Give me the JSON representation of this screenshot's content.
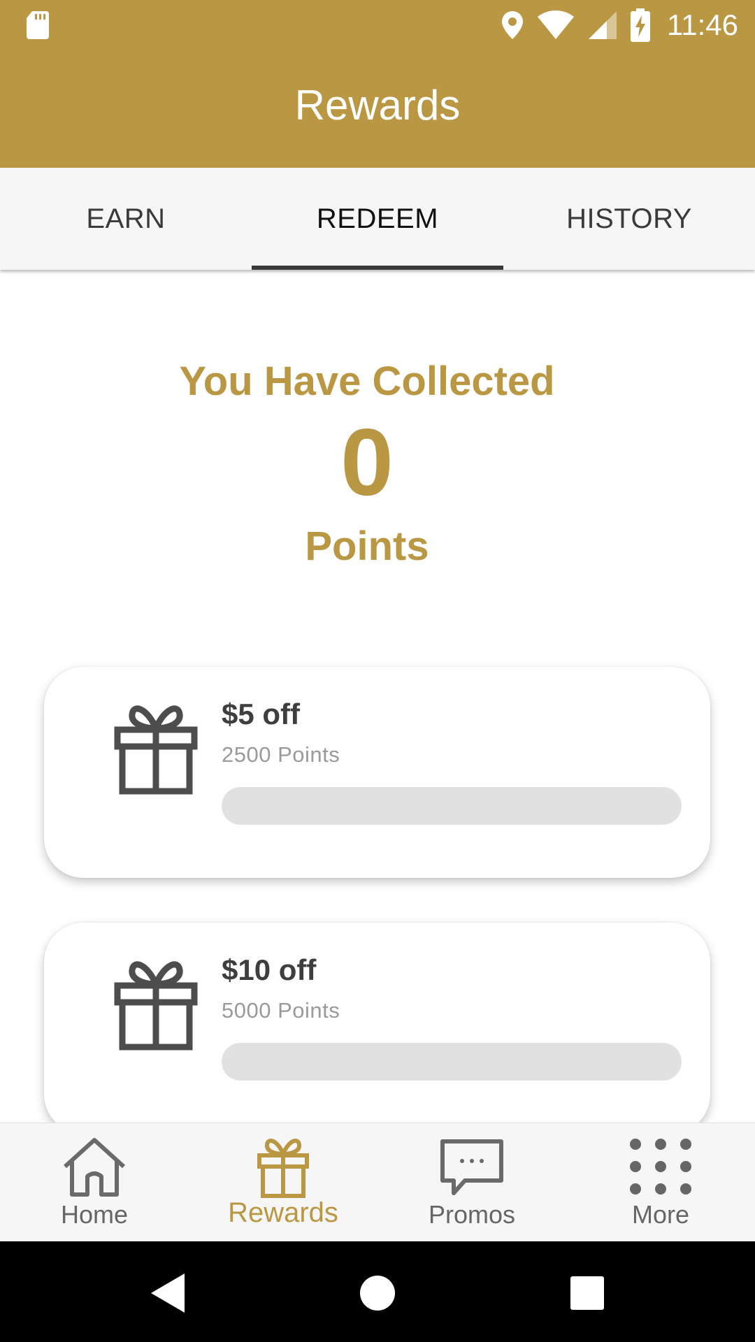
{
  "status_bar": {
    "time": "11:46",
    "icons": [
      "sd-card-icon",
      "location-icon",
      "wifi-icon",
      "signal-icon",
      "battery-charging-icon"
    ]
  },
  "app_bar": {
    "title": "Rewards"
  },
  "tabs": [
    {
      "label": "EARN",
      "active": false
    },
    {
      "label": "REDEEM",
      "active": true
    },
    {
      "label": "HISTORY",
      "active": false
    }
  ],
  "points_summary": {
    "heading": "You Have Collected",
    "value": "0",
    "unit": "Points"
  },
  "rewards": [
    {
      "name": "$5 off",
      "cost": "2500 Points",
      "progress": 0,
      "icon": "gift-icon"
    },
    {
      "name": "$10 off",
      "cost": "5000 Points",
      "progress": 0,
      "icon": "gift-icon"
    }
  ],
  "bottom_nav": [
    {
      "label": "Home",
      "icon": "home-icon",
      "active": false
    },
    {
      "label": "Rewards",
      "icon": "gift-icon",
      "active": true
    },
    {
      "label": "Promos",
      "icon": "chat-bubble-icon",
      "active": false
    },
    {
      "label": "More",
      "icon": "grid-dots-icon",
      "active": false
    }
  ],
  "system_nav": [
    "back-icon",
    "home-circle-icon",
    "recents-icon"
  ],
  "colors": {
    "accent": "#B99743",
    "icon_gray": "#4d4d4d",
    "progress_track": "#e1e1e1"
  }
}
